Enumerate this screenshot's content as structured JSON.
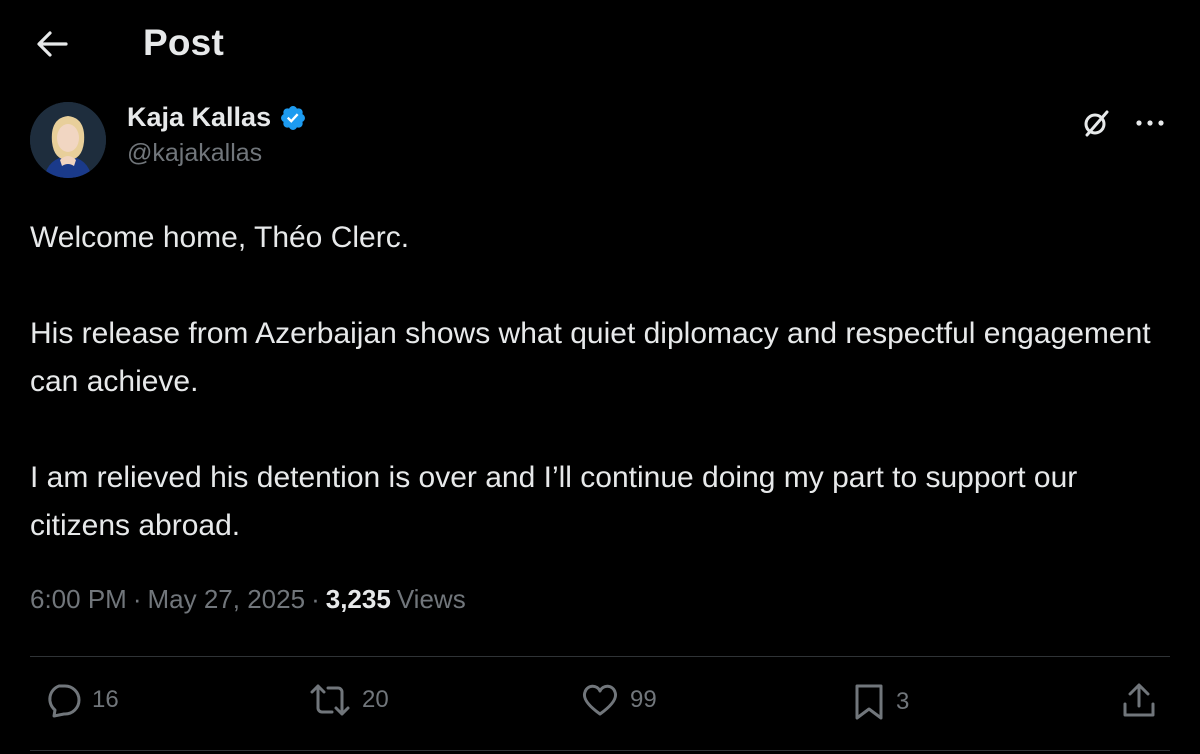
{
  "header": {
    "title": "Post",
    "back_icon": "arrow-left-icon"
  },
  "author": {
    "name": "Kaja Kallas",
    "handle": "@kajakallas",
    "verified": true,
    "verified_color": "#1d9bf0"
  },
  "tweet": {
    "paragraphs": [
      "Welcome home, Théo Clerc.",
      "His release from Azerbaijan shows what quiet diplomacy and respectful engagement can achieve.",
      "I am relieved his detention is over and I’ll continue doing my part to support our citizens abroad."
    ]
  },
  "meta": {
    "time": "6:00 PM",
    "date": "May 27, 2025",
    "views_count": "3,235",
    "views_label": "Views",
    "separator": "·"
  },
  "actions": {
    "replies": "16",
    "reposts": "20",
    "likes": "99",
    "bookmarks": "3"
  },
  "colors": {
    "background": "#000000",
    "text": "#e7e9ea",
    "muted": "#71767b",
    "divider": "#2f3336"
  }
}
